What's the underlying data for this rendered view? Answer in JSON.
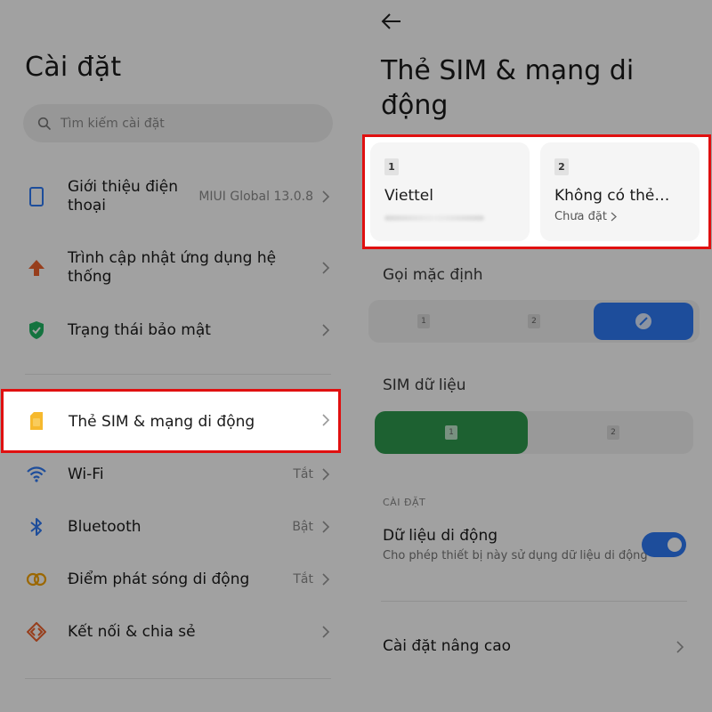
{
  "left": {
    "title": "Cài đặt",
    "search_placeholder": "Tìm kiếm cài đặt",
    "items": [
      {
        "label": "Giới thiệu điện thoại",
        "value": "MIUI Global 13.0.8",
        "icon": "phone-icon"
      },
      {
        "label": "Trình cập nhật ứng dụng hệ thống",
        "value": "",
        "icon": "update-arrow-icon"
      },
      {
        "label": "Trạng thái bảo mật",
        "value": "",
        "icon": "shield-check-icon"
      },
      {
        "label": "Thẻ SIM & mạng di động",
        "value": "",
        "icon": "sim-card-icon"
      },
      {
        "label": "Wi-Fi",
        "value": "Tắt",
        "icon": "wifi-icon"
      },
      {
        "label": "Bluetooth",
        "value": "Bật",
        "icon": "bluetooth-icon"
      },
      {
        "label": "Điểm phát sóng di động",
        "value": "Tắt",
        "icon": "hotspot-icon"
      },
      {
        "label": "Kết nối & chia sẻ",
        "value": "",
        "icon": "connection-share-icon"
      }
    ]
  },
  "right": {
    "title": "Thẻ SIM & mạng di động",
    "sim1": {
      "slot": "1",
      "name": "Viettel"
    },
    "sim2": {
      "slot": "2",
      "name": "Không có thẻ…",
      "status": "Chưa đặt"
    },
    "default_call_label": "Gọi mặc định",
    "default_call_options": [
      "1",
      "2"
    ],
    "sim_data_label": "SIM dữ liệu",
    "sim_data_options": [
      "1",
      "2"
    ],
    "section_caption": "CÀI ĐẶT",
    "mobile_data_label": "Dữ liệu di động",
    "mobile_data_desc": "Cho phép thiết bị này sử dụng dữ liệu di động",
    "mobile_data_on": true,
    "advanced_label": "Cài đặt nâng cao"
  },
  "colors": {
    "highlight": "#e01010",
    "toggle_on": "#2f7af6",
    "call_selected": "#2f7af6",
    "data_selected": "#2e9a4e",
    "sim_icon": "#f5b400"
  }
}
